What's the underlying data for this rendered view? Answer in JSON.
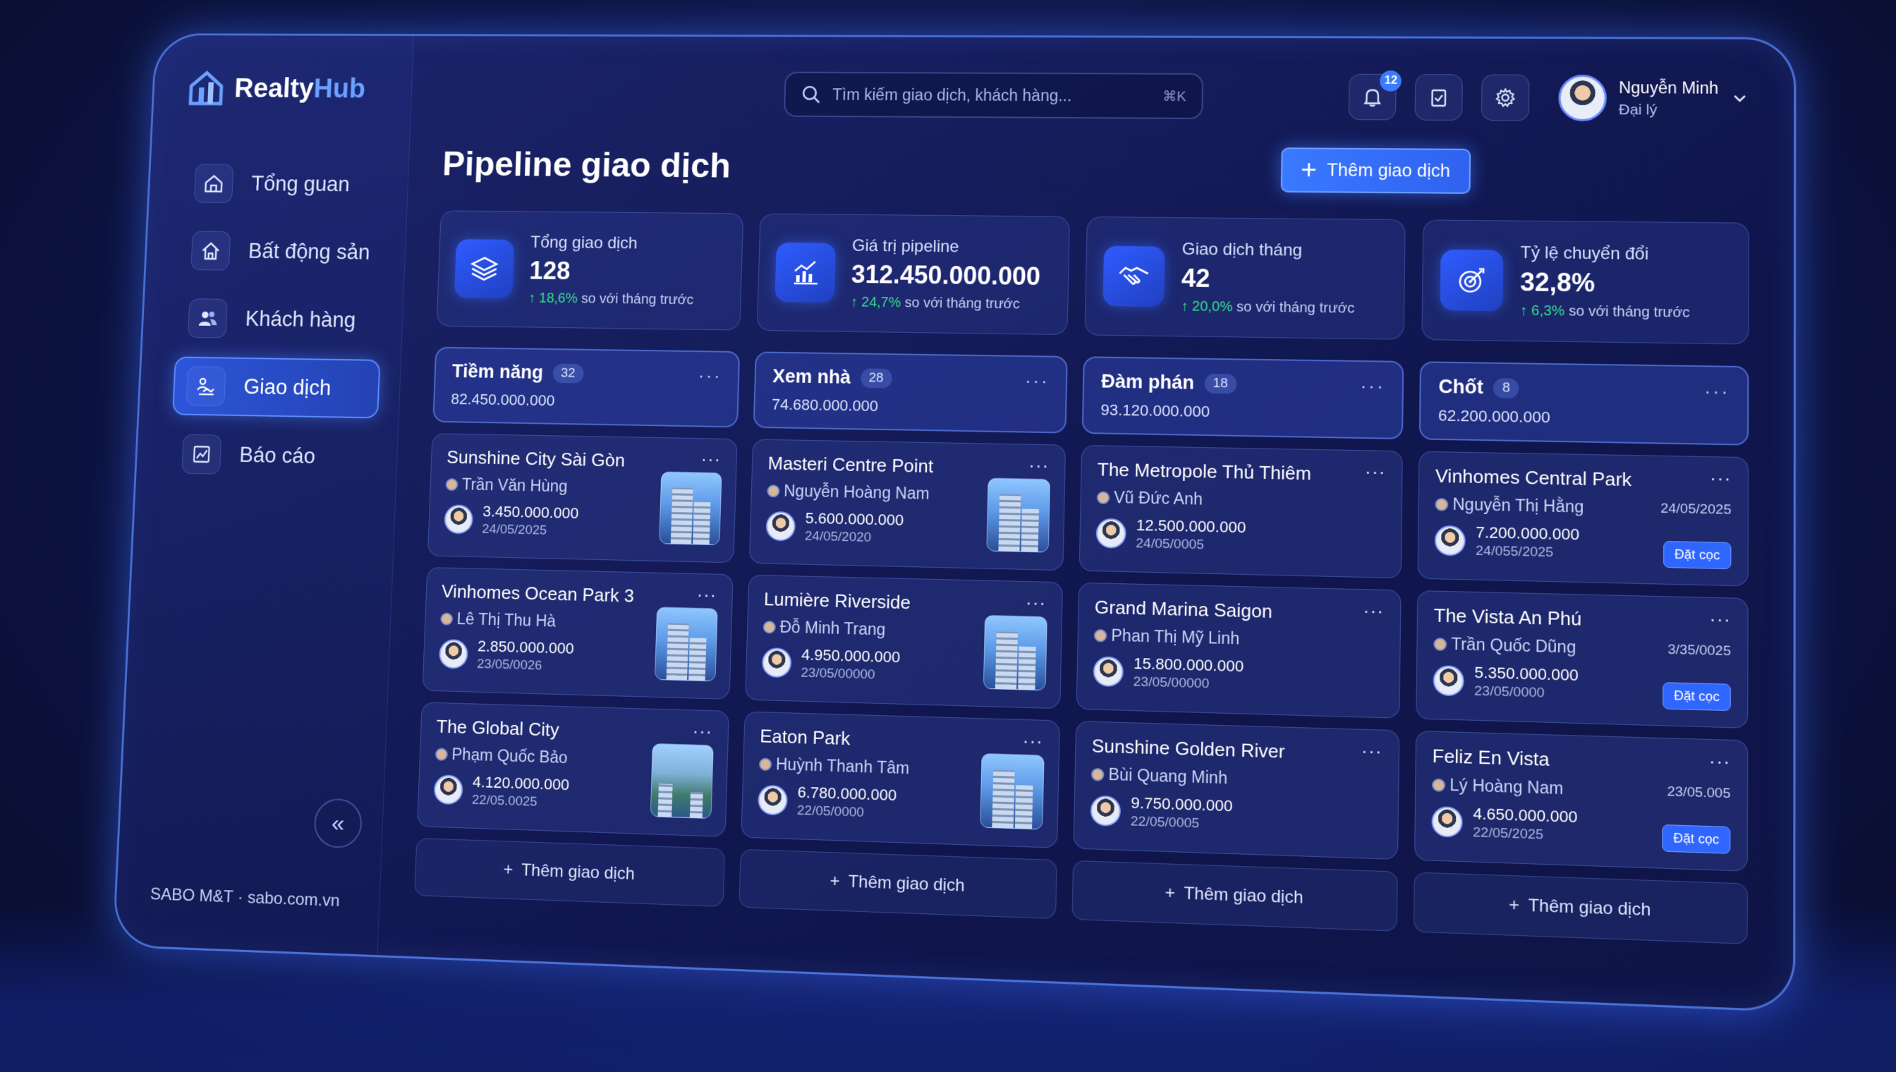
{
  "app": {
    "name_part1": "Realty",
    "name_part2": "Hub"
  },
  "sidebar": {
    "items": [
      {
        "label": "Tổng guan",
        "icon": "home-icon",
        "active": false
      },
      {
        "label": "Bất động sản",
        "icon": "house-icon",
        "active": false
      },
      {
        "label": "Khách hàng",
        "icon": "users-icon",
        "active": false
      },
      {
        "label": "Giao dịch",
        "icon": "handshake-icon",
        "active": true
      },
      {
        "label": "Báo cáo",
        "icon": "report-icon",
        "active": false
      }
    ],
    "collapse_icon": "«",
    "footer": "SABO M&T · sabo.com.vn"
  },
  "topbar": {
    "search_placeholder": "Tìm kiếm giao dịch, khách hàng...",
    "search_shortcut": "⌘K",
    "notification_count": "12",
    "user_name": "Nguyễn Minh",
    "user_role": "Đại lý"
  },
  "page": {
    "title": "Pipeline giao dịch",
    "add_button": "Thêm giao dịch"
  },
  "stats": [
    {
      "label": "Tổng giao dịch",
      "value": "128",
      "delta": "↑ 18,6%",
      "delta_suffix": " so với tháng trước",
      "icon": "layers-icon"
    },
    {
      "label": "Giá trị pipeline",
      "value": "312.450.000.000",
      "delta": "↑ 24,7%",
      "delta_suffix": " so với tháng trước",
      "icon": "chart-icon"
    },
    {
      "label": "Giao dịch tháng",
      "value": "42",
      "delta": "↑ 20,0%",
      "delta_suffix": " so với tháng trước",
      "icon": "handshake-icon"
    },
    {
      "label": "Tỷ lệ chuyển đổi",
      "value": "32,8%",
      "delta": "↑ 6,3%",
      "delta_suffix": " so với tháng trước",
      "icon": "target-icon"
    }
  ],
  "columns": [
    {
      "title": "Tiềm năng",
      "count": "32",
      "amount": "82.450.000.000",
      "cards": [
        {
          "name": "Sunshine City Sài Gòn",
          "owner": "Trần Văn Hùng",
          "price": "3.450.000.000",
          "date": "24/05/2025"
        },
        {
          "name": "Vinhomes Ocean Park 3",
          "owner": "Lê Thị Thu Hà",
          "price": "2.850.000.000",
          "date": "23/05/0026"
        },
        {
          "name": "The Global City",
          "owner": "Phạm Quốc Bảo",
          "price": "4.120.000.000",
          "date": "22/05.0025"
        }
      ],
      "add_label": "Thêm giao dịch"
    },
    {
      "title": "Xem nhà",
      "count": "28",
      "amount": "74.680.000.000",
      "cards": [
        {
          "name": "Masteri Centre Point",
          "owner": "Nguyễn Hoàng Nam",
          "price": "5.600.000.000",
          "date": "24/05/2020"
        },
        {
          "name": "Lumière Riverside",
          "owner": "Đỗ Minh Trang",
          "price": "4.950.000.000",
          "date": "23/05/00000"
        },
        {
          "name": "Eaton Park",
          "owner": "Huỳnh Thanh Tâm",
          "price": "6.780.000.000",
          "date": "22/05/0000"
        }
      ],
      "add_label": "Thêm giao dịch"
    },
    {
      "title": "Đàm phán",
      "count": "18",
      "amount": "93.120.000.000",
      "cards": [
        {
          "name": "The Metropole Thủ Thiêm",
          "owner": "Vũ Đức Anh",
          "price": "12.500.000.000",
          "date": "24/05/0005"
        },
        {
          "name": "Grand Marina Saigon",
          "owner": "Phan Thị Mỹ Linh",
          "price": "15.800.000.000",
          "date": "23/05/00000"
        },
        {
          "name": "Sunshine Golden River",
          "owner": "Bùi Quang Minh",
          "price": "9.750.000.000",
          "date": "22/05/0005"
        }
      ],
      "add_label": "Thêm giao dịch"
    },
    {
      "title": "Chốt",
      "count": "8",
      "amount": "62.200.000.000",
      "cards": [
        {
          "name": "Vinhomes Central Park",
          "owner": "Nguyễn Thị Hằng",
          "price": "7.200.000.000",
          "date": "24/055/2025",
          "right_date": "24/05/2025",
          "badge": "Đặt cọc"
        },
        {
          "name": "The Vista An Phú",
          "owner": "Trần Quốc Dũng",
          "price": "5.350.000.000",
          "date": "23/05/0000",
          "right_date": "3/35/0025",
          "badge": "Đặt cọc"
        },
        {
          "name": "Feliz En Vista",
          "owner": "Lý Hoàng Nam",
          "price": "4.650.000.000",
          "date": "22/05/2025",
          "right_date": "23/05.005",
          "badge": "Đặt cọc"
        }
      ],
      "add_label": "Thêm giao dịch"
    }
  ]
}
